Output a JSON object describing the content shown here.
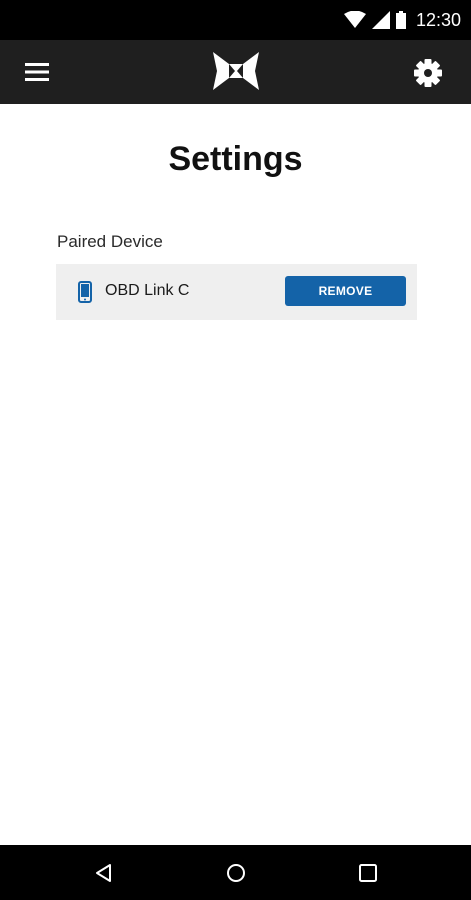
{
  "status_bar": {
    "time": "12:30",
    "icons": [
      "wifi-icon",
      "signal-icon",
      "battery-icon"
    ]
  },
  "app_bar": {
    "menu_icon": "hamburger-menu-icon",
    "logo": "brand-logo",
    "settings_icon": "gear-icon"
  },
  "main": {
    "title": "Settings",
    "paired_section": {
      "label": "Paired Device",
      "device": {
        "icon": "phone-icon",
        "name": "OBD Link C",
        "remove_label": "REMOVE"
      }
    }
  },
  "nav_bar": {
    "back_icon": "back-triangle-icon",
    "home_icon": "home-circle-icon",
    "recents_icon": "recents-square-icon"
  },
  "colors": {
    "app_bar": "#1f1f1f",
    "accent_button": "#1463a8",
    "device_row_bg": "#efefef"
  }
}
